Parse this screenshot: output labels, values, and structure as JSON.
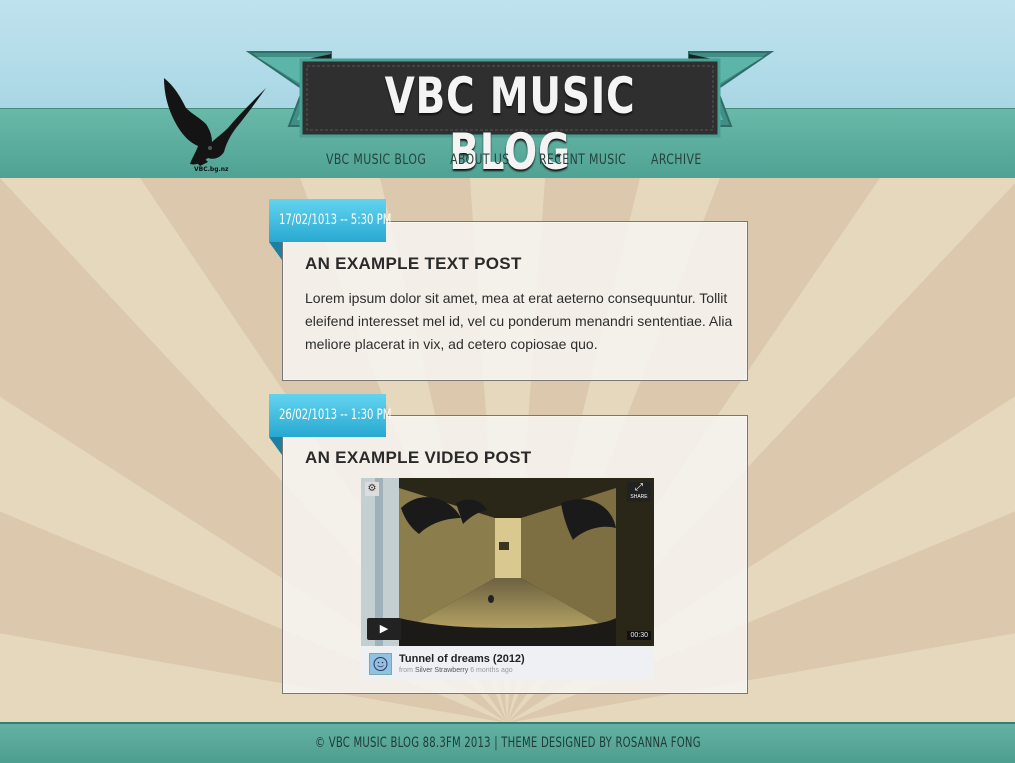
{
  "header": {
    "title": "VBC MUSIC BLOG",
    "logo_text": "VBC.bg.nz"
  },
  "nav": {
    "items": [
      {
        "label": "VBC MUSIC BLOG"
      },
      {
        "label": "ABOUT US"
      },
      {
        "label": "RECENT MUSIC"
      },
      {
        "label": "ARCHIVE"
      }
    ]
  },
  "posts": [
    {
      "date": "17/02/1013 -- 5:30 PM",
      "title": "AN EXAMPLE TEXT POST",
      "body": "Lorem ipsum dolor sit amet, mea at erat aeterno consequuntur. Tollit eleifend interesset mel id, vel cu ponderum menandri sententiae. Alia meliore placerat in vix, ad cetero copiosae quo."
    },
    {
      "date": "26/02/1013 -- 1:30 PM",
      "title": "AN EXAMPLE VIDEO POST",
      "video": {
        "title": "Tunnel of dreams (2012)",
        "from_label": "from",
        "author": "Silver Strawberry",
        "age": "6 months ago",
        "duration": "00:30",
        "share_label": "SHARE"
      }
    }
  ],
  "footer": {
    "text": "© VBC MUSIC BLOG 88.3FM 2013 | THEME DESIGNED BY ROSANNA FONG"
  },
  "colors": {
    "sky": "#bfe3ee",
    "teal": "#5aac9d",
    "date_tag": "#3bbde2",
    "background": "#dcc9ad",
    "banner": "#2e2e2e"
  }
}
